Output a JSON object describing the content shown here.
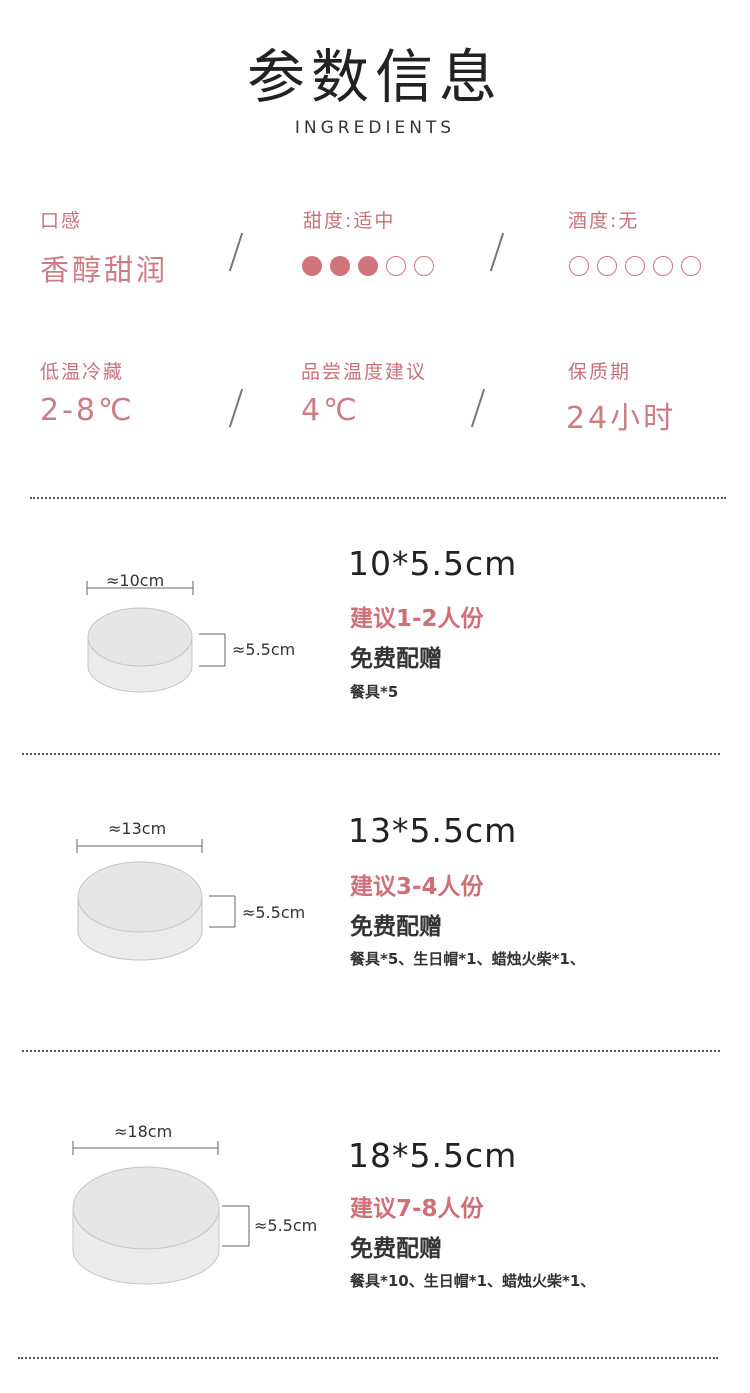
{
  "header": {
    "title": "参数信息",
    "subtitle": "INGREDIENTS"
  },
  "params": [
    {
      "label": "口感",
      "value": "香醇甜润"
    },
    {
      "label": "甜度:适中",
      "level": 3,
      "max": 5
    },
    {
      "label": "酒度:无",
      "level": 0,
      "max": 5
    },
    {
      "label": "低温冷藏",
      "value": "2-8℃"
    },
    {
      "label": "品尝温度建议",
      "value": "4℃"
    },
    {
      "label": "保质期",
      "value": "24小时"
    }
  ],
  "colors": {
    "accent": "#cb7d84",
    "dot_filled": "#d0737b",
    "text_dark": "#222222"
  },
  "sizes": [
    {
      "diameter_label": "≈10cm",
      "height_label": "≈5.5cm",
      "title": "10*5.5cm",
      "serving": "建议1-2人份",
      "gift_title": "免费配赠",
      "gift_items": "餐具*5"
    },
    {
      "diameter_label": "≈13cm",
      "height_label": "≈5.5cm",
      "title": "13*5.5cm",
      "serving": "建议3-4人份",
      "gift_title": "免费配赠",
      "gift_items": "餐具*5、生日帽*1、蜡烛火柴*1、"
    },
    {
      "diameter_label": "≈18cm",
      "height_label": "≈5.5cm",
      "title": "18*5.5cm",
      "serving": "建议7-8人份",
      "gift_title": "免费配赠",
      "gift_items": "餐具*10、生日帽*1、蜡烛火柴*1、"
    }
  ]
}
